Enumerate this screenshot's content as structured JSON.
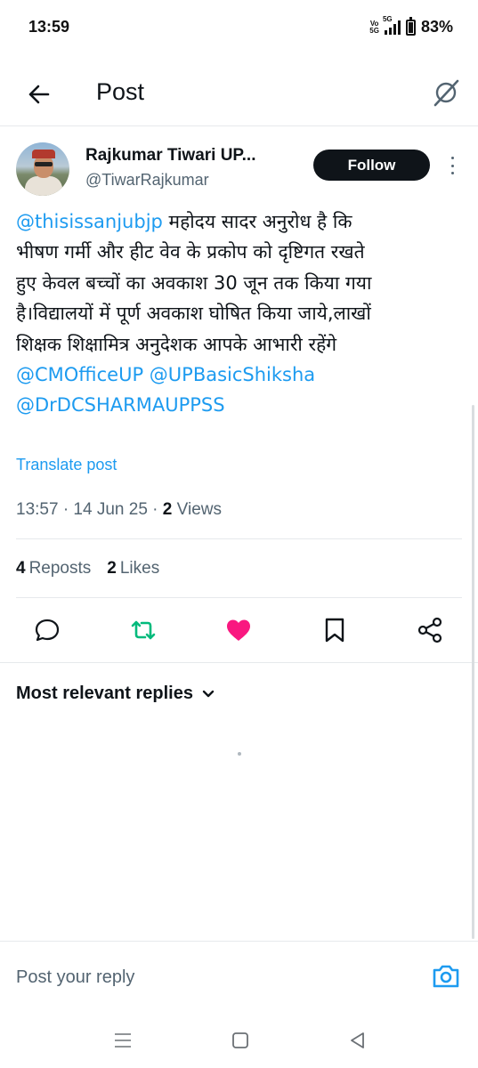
{
  "status_bar": {
    "time": "13:59",
    "network_top": "Vo",
    "network_bottom": "5G",
    "network_type": "5G",
    "battery": "83%"
  },
  "topbar": {
    "title": "Post",
    "back_icon": "arrow-left-icon",
    "grok_icon": "grok-slash-circle-icon"
  },
  "author": {
    "name": "Rajkumar Tiwari UP...",
    "handle": "@TiwarRajkumar",
    "follow_label": "Follow"
  },
  "post": {
    "lines": [
      {
        "mention": "@thisissanjubjp",
        "text": " महोदय सादर अनुरोध है कि"
      },
      {
        "text": "भीषण गर्मी और हीट वेव के प्रकोप को दृष्टिगत रखते"
      },
      {
        "text": "हुए केवल बच्चों का अवकाश 30 जून तक किया गया"
      },
      {
        "text": "है।विद्यालयों में पूर्ण अवकाश घोषित किया जाये,लाखों"
      },
      {
        "text": "शिक्षक शिक्षामित्र अनुदेशक आपके आभारी रहेंगे"
      },
      {
        "mention": "@CMOfficeUP @UPBasicShiksha"
      },
      {
        "mention": "@DrDCSHARMAUPPSS"
      }
    ],
    "translate_label": "Translate post",
    "timestamp": "13:57 · 14 Jun 25 · ",
    "views_count": "2",
    "views_label": " Views"
  },
  "engagement": {
    "reposts_count": "4",
    "reposts_label": "Reposts",
    "likes_count": "2",
    "likes_label": "Likes"
  },
  "actions": {
    "icons": [
      "reply-icon",
      "repost-icon",
      "like-icon",
      "bookmark-icon",
      "share-icon"
    ],
    "repost_color": "#00ba7c",
    "like_color": "#f91880"
  },
  "replies": {
    "sort_label": "Most relevant replies"
  },
  "composer": {
    "placeholder": "Post your reply",
    "camera_color": "#1d9bf0"
  },
  "colors": {
    "accent": "#1d9bf0",
    "text": "#0f1419",
    "muted": "#536471"
  }
}
